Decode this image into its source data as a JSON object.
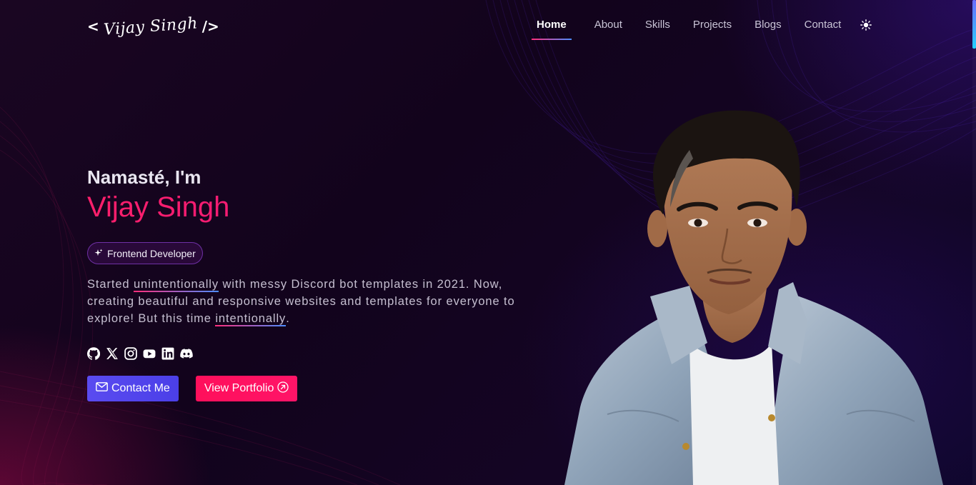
{
  "brand": {
    "logo_open": "<",
    "logo_text": "Vijay Singh",
    "logo_close": "/>"
  },
  "nav": {
    "items": [
      {
        "label": "Home",
        "active": true
      },
      {
        "label": "About"
      },
      {
        "label": "Skills"
      },
      {
        "label": "Projects"
      },
      {
        "label": "Blogs"
      },
      {
        "label": "Contact"
      }
    ],
    "theme_icon": "sun-icon"
  },
  "hero": {
    "greeting": "Namasté, I'm",
    "name": "Vijay Singh",
    "role": "Frontend Developer",
    "bio": {
      "part1": "Started ",
      "highlight1": "unintentionally",
      "part2": " with messy Discord bot templates in 2021. Now, creating beautiful and responsive websites and templates for everyone to explore! But this time ",
      "highlight2": "intentionally",
      "part3": "."
    },
    "socials": [
      "github-icon",
      "x-icon",
      "instagram-icon",
      "youtube-icon",
      "linkedin-icon",
      "discord-icon"
    ],
    "cta_primary": "Contact Me",
    "cta_secondary": "View Portfolio"
  },
  "colors": {
    "accent_pink": "#ff1468",
    "accent_indigo": "#4b3fe8",
    "background": "#14041f"
  }
}
